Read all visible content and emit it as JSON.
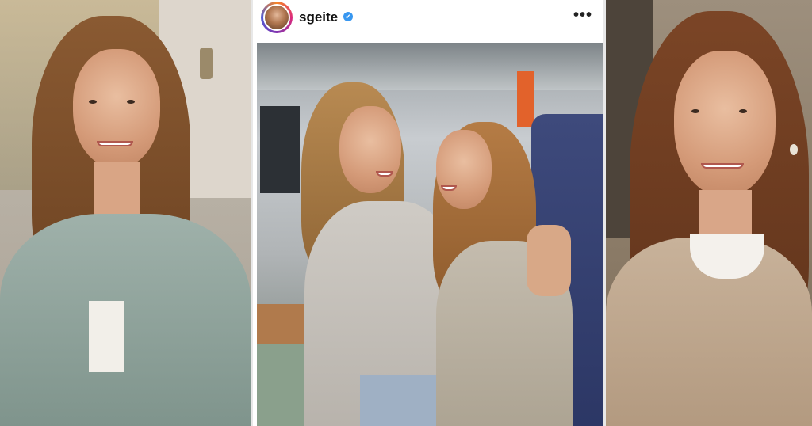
{
  "post": {
    "username": "sgeite",
    "verified_mark": "✔",
    "more_glyph": "•••",
    "icons": {
      "avatar": "profile-avatar",
      "verified": "verified-badge-icon",
      "more": "more-options-icon"
    }
  },
  "colors": {
    "verified_blue": "#3897f0",
    "story_ring": [
      "#f58529",
      "#dd2a7b",
      "#8134af",
      "#515bd4"
    ]
  }
}
